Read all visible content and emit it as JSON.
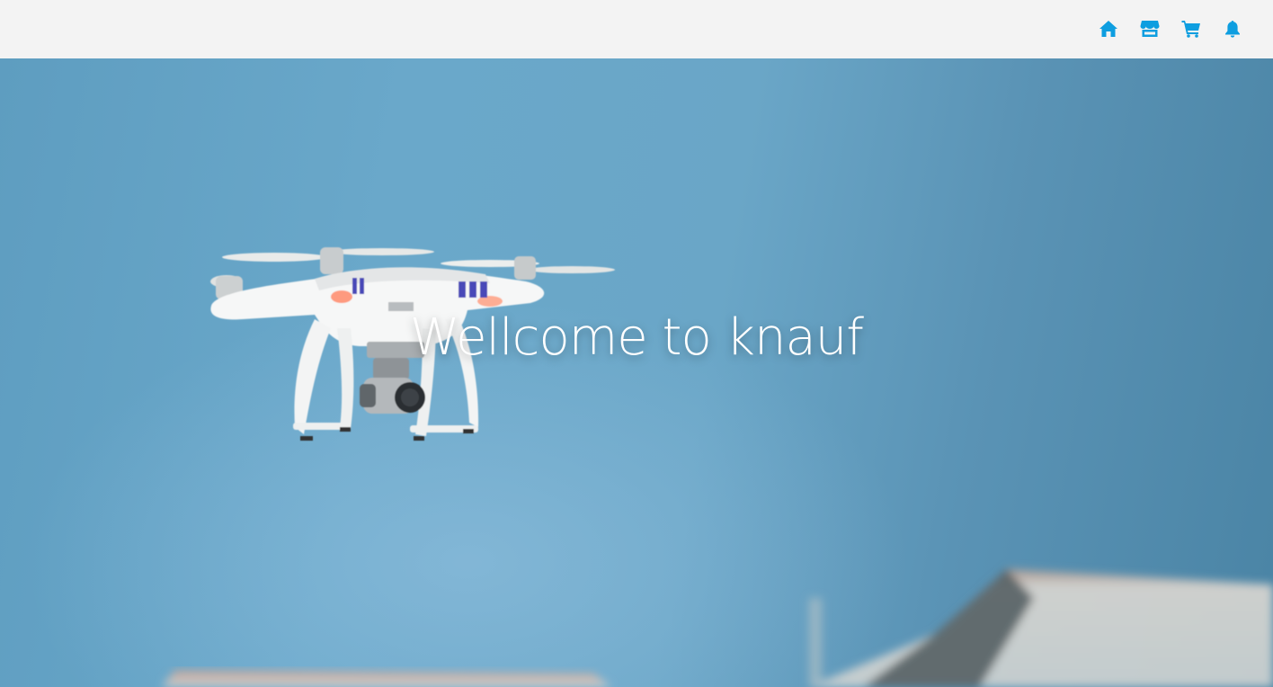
{
  "header": {
    "nav": [
      {
        "icon": "home-icon"
      },
      {
        "icon": "store-icon"
      },
      {
        "icon": "cart-icon"
      },
      {
        "icon": "bell-icon"
      }
    ],
    "accent_color": "#0e9ee0"
  },
  "hero": {
    "title": "Wellcome to knauf",
    "image": "drone-in-sky"
  }
}
